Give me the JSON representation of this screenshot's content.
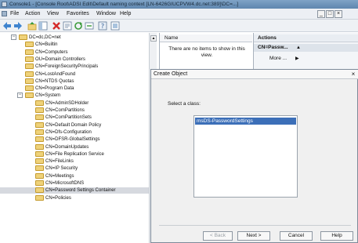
{
  "window": {
    "title": "Console1 - [Console Root\\ADSI Edit\\Default naming context [LN-6426GIUCPVW4.dc.net:389]\\DC=...]",
    "mdi_controls": [
      "_",
      "□",
      "×"
    ]
  },
  "menu": {
    "items": [
      "File",
      "Action",
      "View",
      "Favorites",
      "Window",
      "Help"
    ]
  },
  "toolbar": {
    "icons": [
      "back-icon",
      "forward-icon",
      "up-folder-icon",
      "show-hide-tree-icon",
      "delete-icon",
      "properties-icon",
      "refresh-icon",
      "export-icon",
      "help-icon",
      "properties-sheet-icon"
    ]
  },
  "tree": {
    "rows": [
      {
        "label": "DC=dc,DC=net",
        "expander": "−",
        "level": 0
      },
      {
        "label": "CN=Builtin",
        "expander": "",
        "level": 1
      },
      {
        "label": "CN=Computers",
        "expander": "",
        "level": 1
      },
      {
        "label": "OU=Domain Controllers",
        "expander": "",
        "level": 1
      },
      {
        "label": "CN=ForeignSecurityPrincipals",
        "expander": "",
        "level": 1
      },
      {
        "label": "CN=LostAndFound",
        "expander": "",
        "level": 1
      },
      {
        "label": "CN=NTDS Quotas",
        "expander": "",
        "level": 1
      },
      {
        "label": "CN=Program Data",
        "expander": "",
        "level": 1
      },
      {
        "label": "CN=System",
        "expander": "−",
        "level": 1
      },
      {
        "label": "CN=AdminSDHolder",
        "expander": "",
        "level": 2
      },
      {
        "label": "CN=ComPartitions",
        "expander": "",
        "level": 2
      },
      {
        "label": "CN=ComPartitionSets",
        "expander": "",
        "level": 2
      },
      {
        "label": "CN=Default Domain Policy",
        "expander": "",
        "level": 2
      },
      {
        "label": "CN=Dfs-Configuration",
        "expander": "",
        "level": 2
      },
      {
        "label": "CN=DFSR-GlobalSettings",
        "expander": "",
        "level": 2
      },
      {
        "label": "CN=DomainUpdates",
        "expander": "",
        "level": 2
      },
      {
        "label": "CN=File Replication Service",
        "expander": "",
        "level": 2
      },
      {
        "label": "CN=FileLinks",
        "expander": "",
        "level": 2
      },
      {
        "label": "CN=IP Security",
        "expander": "",
        "level": 2
      },
      {
        "label": "CN=Meetings",
        "expander": "",
        "level": 2
      },
      {
        "label": "CN=MicrosoftDNS",
        "expander": "",
        "level": 2
      },
      {
        "label": "CN=Password Settings Container",
        "expander": "",
        "level": 2,
        "selected": true
      },
      {
        "label": "CN=Policies",
        "expander": "",
        "level": 2
      }
    ]
  },
  "name_pane": {
    "header": "Name",
    "empty_message": "There are no items to show in this view."
  },
  "actions_pane": {
    "header": "Actions",
    "sub_header": "CN=Passw...",
    "sub_arrow": "▲",
    "more_label": "More ...",
    "more_arrow": "▶"
  },
  "dialog": {
    "title": "Create Object",
    "close_glyph": "×",
    "prompt": "Select a class:",
    "classes": [
      "msDS-PasswordSettings"
    ],
    "buttons": {
      "back": "< Back",
      "next": "Next >",
      "cancel": "Cancel",
      "help": "Help"
    }
  },
  "colors": {
    "selection": "#3c6fb8",
    "folder": "#efd27a",
    "titlebar": "#6f93b9"
  }
}
